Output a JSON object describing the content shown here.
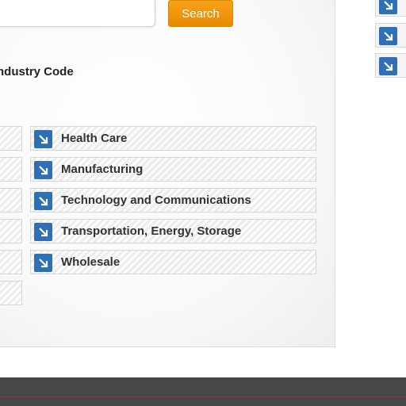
{
  "search": {
    "button_label": "Search"
  },
  "filter": {
    "heading": "ndustry Code"
  },
  "categories": [
    {
      "label": "Health Care"
    },
    {
      "label": "Manufacturing"
    },
    {
      "label": "Technology and Communications"
    },
    {
      "label": "Transportation, Energy, Storage"
    },
    {
      "label": "Wholesale"
    }
  ],
  "colors": {
    "accent_orange": "#f29a12",
    "icon_blue": "#2f6fb5",
    "footer": "#474747"
  },
  "icons": {
    "category_icon": "arrow-down-right-icon"
  }
}
